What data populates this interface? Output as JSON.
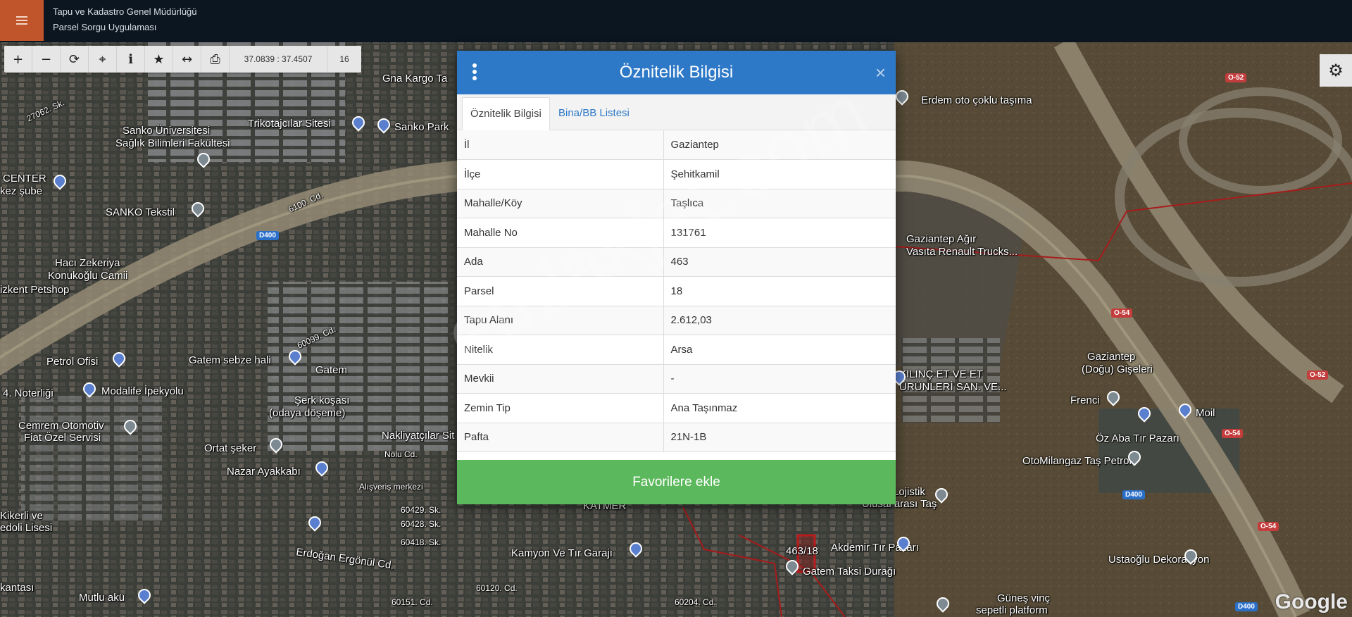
{
  "app": {
    "title_line1": "Tapu ve Kadastro Genel Müdürlüğü",
    "title_line2": "Parsel Sorgu Uygulaması"
  },
  "toolbar": {
    "tools": [
      {
        "name": "zoom-in",
        "glyph": "+"
      },
      {
        "name": "zoom-out",
        "glyph": "−"
      },
      {
        "name": "refresh",
        "glyph": "⟳"
      },
      {
        "name": "locate",
        "glyph": "⌖"
      },
      {
        "name": "info",
        "glyph": "ℹ"
      },
      {
        "name": "favorite",
        "glyph": "★"
      },
      {
        "name": "measure",
        "glyph": "↔"
      },
      {
        "name": "print",
        "glyph": "⎙"
      }
    ],
    "coordinates": "37.0839 : 37.4507",
    "zoom_level": "16"
  },
  "settings_icon": "⚙",
  "modal": {
    "title": "Öznitelik Bilgisi",
    "close_glyph": "×",
    "tabs": [
      {
        "label": "Öznitelik Bilgisi",
        "active": true
      },
      {
        "label": "Bina/BB Listesi",
        "active": false
      }
    ],
    "rows": [
      {
        "key": "İl",
        "value": "Gaziantep"
      },
      {
        "key": "İlçe",
        "value": "Şehitkamil"
      },
      {
        "key": "Mahalle/Köy",
        "value": "Taşlıca"
      },
      {
        "key": "Mahalle No",
        "value": "131761"
      },
      {
        "key": "Ada",
        "value": "463"
      },
      {
        "key": "Parsel",
        "value": "18"
      },
      {
        "key": "Tapu Alanı",
        "value": "2.612,03"
      },
      {
        "key": "Nitelik",
        "value": "Arsa"
      },
      {
        "key": "Mevkii",
        "value": "-"
      },
      {
        "key": "Zemin Tip",
        "value": "Ana Taşınmaz"
      },
      {
        "key": "Pafta",
        "value": "21N-1B"
      }
    ],
    "favorite_button": "Favorilere ekle"
  },
  "watermark": "emlakjet.com",
  "map": {
    "labels": [
      {
        "text": "Gna Kargo Ta",
        "small": false
      },
      {
        "text": "27062. Sk.",
        "small": true
      },
      {
        "text": "Trikotajcılar Sitesi",
        "small": false
      },
      {
        "text": "Sanko Park",
        "small": false
      },
      {
        "text": "Sanko Üniversitesi",
        "small": false
      },
      {
        "text": "Sağlık Bilimleri Fakültesi",
        "small": false
      },
      {
        "text": "CENTER",
        "small": false
      },
      {
        "text": "kez şube",
        "small": false
      },
      {
        "text": "SANKO Tekstil",
        "small": false
      },
      {
        "text": "6100. Cd.",
        "small": true
      },
      {
        "text": "Hacı Zekeriya",
        "small": false
      },
      {
        "text": "Konukoğlu Camii",
        "small": false
      },
      {
        "text": "izkent Petshop",
        "small": false
      },
      {
        "text": "Petrol Ofisi",
        "small": false
      },
      {
        "text": "Gatem sebze hali",
        "small": false
      },
      {
        "text": "Gatem",
        "small": false
      },
      {
        "text": "4. Noterliği",
        "small": false
      },
      {
        "text": "Modalife İpekyolu",
        "small": false
      },
      {
        "text": "Şerk koşası",
        "small": false
      },
      {
        "text": "(odaya döşeme)",
        "small": false
      },
      {
        "text": "Cemrem Otomotiv",
        "small": false
      },
      {
        "text": "Fiat Özel Servisi",
        "small": false
      },
      {
        "text": "Nakliyatçılar Sit",
        "small": false
      },
      {
        "text": "Ortat şeker",
        "small": false
      },
      {
        "text": "Nazar Ayakkabı",
        "small": false
      },
      {
        "text": "Alışveriş merkezi",
        "small": true
      },
      {
        "text": "60429. Sk.",
        "small": true
      },
      {
        "text": "60428. Sk.",
        "small": true
      },
      {
        "text": "60418. Sk.",
        "small": true
      },
      {
        "text": "Erdoğan Ergönül Cd.",
        "small": false
      },
      {
        "text": "Kamyon Ve Tır Garajı",
        "small": false
      },
      {
        "text": "KATMER",
        "small": false
      },
      {
        "text": "Mutlu akü",
        "small": false
      },
      {
        "text": "kantası",
        "small": false
      },
      {
        "text": "60120. Cd.",
        "small": true
      },
      {
        "text": "60204. Cd.",
        "small": true
      },
      {
        "text": "60151. Cd.",
        "small": true
      },
      {
        "text": "Erdem oto çoklu taşıma",
        "small": false
      },
      {
        "text": "Gaziantep Ağır",
        "small": false
      },
      {
        "text": "Vasıta Renault Trucks...",
        "small": false
      },
      {
        "text": "KILINÇ ET VE ET",
        "small": false
      },
      {
        "text": "ÜRÜNLERİ SAN. VE...",
        "small": false
      },
      {
        "text": "Gaziantep",
        "small": false
      },
      {
        "text": "(Doğu) Gişeleri",
        "small": false
      },
      {
        "text": "Frenci",
        "small": false
      },
      {
        "text": "Moil",
        "small": false
      },
      {
        "text": "Öz Aba Tır Pazarı",
        "small": false
      },
      {
        "text": "OtoMilangaz Taş Petrol",
        "small": false
      },
      {
        "text": "Lojistik",
        "small": false
      },
      {
        "text": "Ulusal arası Taş",
        "small": false
      },
      {
        "text": "Akdemir Tır Pazarı",
        "small": false
      },
      {
        "text": "Gatem Taksi Durağı",
        "small": false
      },
      {
        "text": "463/18",
        "small": false
      },
      {
        "text": "Ustaoğlu Dekorasyon",
        "small": false
      },
      {
        "text": "Güneş vinç",
        "small": false
      },
      {
        "text": "sepetli platform",
        "small": false
      },
      {
        "text": "Nolu Cd.",
        "small": true
      },
      {
        "text": "60099. Cd.",
        "small": true
      },
      {
        "text": "Kikerli ve",
        "small": false
      },
      {
        "text": "edoli Lisesi",
        "small": false
      }
    ],
    "road_shields": [
      "D400",
      "O-52",
      "O-54",
      "O-54",
      "D400",
      "O-52",
      "O-54",
      "D400"
    ],
    "provider": "Google"
  }
}
